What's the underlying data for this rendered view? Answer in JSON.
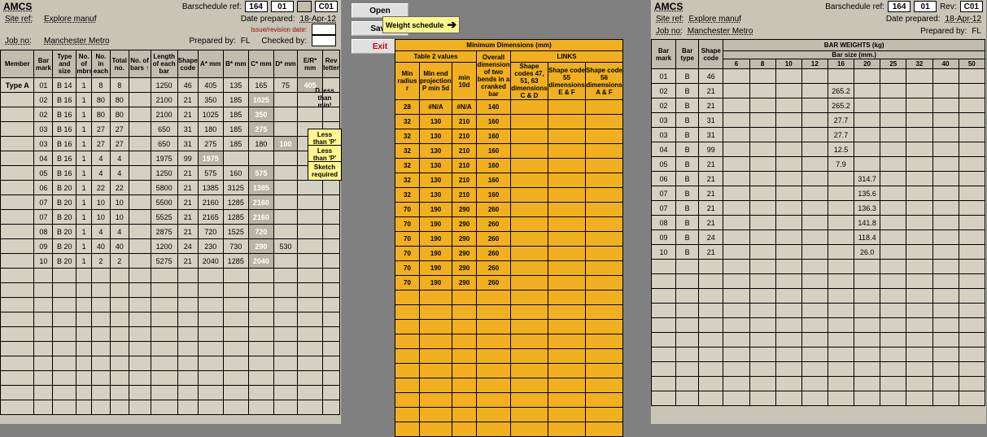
{
  "left": {
    "title": "AMCS",
    "bsr_label": "Barschedule ref:",
    "bsr": [
      "164",
      "01"
    ],
    "rev": "C01",
    "site_l": "Site ref:",
    "site": "Explore manuf",
    "date_l": "Date prepared:",
    "date": "18-Apr-12",
    "rev_note": "Issue/revision date:",
    "job_l": "Job no:",
    "job": "Manchester Metro",
    "prep_l": "Prepared by:",
    "prep": "FL",
    "chk_l": "Checked by:",
    "cols": [
      "Member",
      "Bar mark",
      "Type and size",
      "No. of mbrs",
      "No. in each",
      "Total no.",
      "No. of bars ↑",
      "Length of each bar",
      "Shape code",
      "A* mm",
      "B* mm",
      "C* mm",
      "D* mm",
      "E/R* mm",
      "Rev letter"
    ],
    "member": "Type A",
    "rows": [
      [
        "01",
        "B 14",
        "1",
        "8",
        "8",
        "",
        "1250",
        "46",
        "405",
        "135",
        "165",
        "75",
        "405",
        ""
      ],
      [
        "02",
        "B 16",
        "1",
        "80",
        "80",
        "",
        "2100",
        "21",
        "350",
        "185",
        "1025",
        "",
        "",
        ""
      ],
      [
        "02",
        "B 16",
        "1",
        "80",
        "80",
        "",
        "2100",
        "21",
        "1025",
        "185",
        "350",
        "",
        "",
        ""
      ],
      [
        "03",
        "B 16",
        "1",
        "27",
        "27",
        "",
        "650",
        "31",
        "180",
        "185",
        "275",
        "",
        "",
        ""
      ],
      [
        "03",
        "B 16",
        "1",
        "27",
        "27",
        "",
        "650",
        "31",
        "275",
        "185",
        "180",
        "100",
        "",
        ""
      ],
      [
        "04",
        "B 16",
        "1",
        "4",
        "4",
        "",
        "1975",
        "99",
        "1975",
        "",
        "",
        "",
        "",
        ""
      ],
      [
        "05",
        "B 16",
        "1",
        "4",
        "4",
        "",
        "1250",
        "21",
        "575",
        "160",
        "575",
        "",
        "",
        ""
      ],
      [
        "06",
        "B 20",
        "1",
        "22",
        "22",
        "",
        "5800",
        "21",
        "1385",
        "3125",
        "1385",
        "",
        "",
        ""
      ],
      [
        "07",
        "B 20",
        "1",
        "10",
        "10",
        "",
        "5500",
        "21",
        "2160",
        "1285",
        "2160",
        "",
        "",
        ""
      ],
      [
        "07",
        "B 20",
        "1",
        "10",
        "10",
        "",
        "5525",
        "21",
        "2165",
        "1285",
        "2160",
        "",
        "",
        ""
      ],
      [
        "08",
        "B 20",
        "1",
        "4",
        "4",
        "",
        "2875",
        "21",
        "720",
        "1525",
        "720",
        "",
        "",
        ""
      ],
      [
        "09",
        "B 20",
        "1",
        "40",
        "40",
        "",
        "1200",
        "24",
        "230",
        "730",
        "290",
        "530",
        "",
        ""
      ],
      [
        "10",
        "B 20",
        "1",
        "2",
        "2",
        "",
        "5275",
        "21",
        "2040",
        "1285",
        "2040",
        "",
        "",
        ""
      ]
    ],
    "whiteVals": {
      "0": {
        "12": "405"
      },
      "1": {
        "10": "1025"
      },
      "2": {
        "10": "350"
      },
      "3": {
        "10": "275"
      },
      "4": {
        "11": "100"
      },
      "5": {
        "8": "1975"
      },
      "6": {
        "10": "575"
      },
      "7": {
        "10": "1385"
      },
      "8": {
        "10": "2160"
      },
      "9": {
        "10": "2160"
      },
      "10": {
        "10": "720"
      },
      "11": {
        "10": "290"
      },
      "12": {
        "10": "2040"
      }
    },
    "warn1": "D less than min!",
    "notes": [
      "Less than 'P' in table",
      "Less than 'P' in table",
      "Sketch required"
    ]
  },
  "mid": {
    "btns": [
      "Open",
      "Save",
      "Exit"
    ],
    "arrow": "Weight schedule",
    "title": "Minimum Dimensions (mm)",
    "h2": [
      "Table 2 values",
      "Overall dimension of two bends in a cranked bar",
      "LINKS"
    ],
    "h3": [
      "Min radius r",
      "Min end projection, P min 5d",
      "min 10d",
      "Shape codes 47, 51, 63 dimensions C & D",
      "Shape code 55 dimensions E & F",
      "Shape code 56 dimensions A & F"
    ],
    "rows": [
      [
        "28",
        "#N/A",
        "#N/A",
        "140",
        "",
        "",
        ""
      ],
      [
        "32",
        "130",
        "210",
        "160",
        "",
        "",
        ""
      ],
      [
        "32",
        "130",
        "210",
        "160",
        "",
        "",
        ""
      ],
      [
        "32",
        "130",
        "210",
        "160",
        "",
        "",
        ""
      ],
      [
        "32",
        "130",
        "210",
        "160",
        "",
        "",
        ""
      ],
      [
        "32",
        "130",
        "210",
        "160",
        "",
        "",
        ""
      ],
      [
        "32",
        "130",
        "210",
        "160",
        "",
        "",
        ""
      ],
      [
        "70",
        "190",
        "290",
        "260",
        "",
        "",
        ""
      ],
      [
        "70",
        "190",
        "290",
        "260",
        "",
        "",
        ""
      ],
      [
        "70",
        "190",
        "290",
        "260",
        "",
        "",
        ""
      ],
      [
        "70",
        "190",
        "290",
        "260",
        "",
        "",
        ""
      ],
      [
        "70",
        "190",
        "290",
        "260",
        "",
        "",
        ""
      ],
      [
        "70",
        "190",
        "290",
        "260",
        "",
        "",
        ""
      ]
    ]
  },
  "right": {
    "title": "AMCS",
    "bsr_label": "Barschedule ref:",
    "bsr": [
      "164",
      "01"
    ],
    "rev_l": "Rev:",
    "rev": "C01",
    "site_l": "Site ref:",
    "site": "Explore manuf",
    "date_l": "Date prepared:",
    "date": "18-Apr-12",
    "job_l": "Job no:",
    "job": "Manchester Metro",
    "prep_l": "Prepared by:",
    "prep": "FL",
    "cols_l": [
      "Bar mark",
      "Bar type",
      "Shape code"
    ],
    "weights_title": "BAR WEIGHTS (kg)",
    "sub": "Bar size (mm.)",
    "sizes": [
      "6",
      "8",
      "10",
      "12",
      "16",
      "20",
      "25",
      "32",
      "40",
      "50"
    ],
    "rows": [
      [
        "01",
        "B",
        "46",
        "",
        "",
        "",
        "",
        "",
        "",
        "",
        "",
        "",
        ""
      ],
      [
        "02",
        "B",
        "21",
        "",
        "",
        "",
        "",
        "265.2",
        "",
        "",
        "",
        "",
        ""
      ],
      [
        "02",
        "B",
        "21",
        "",
        "",
        "",
        "",
        "265.2",
        "",
        "",
        "",
        "",
        ""
      ],
      [
        "03",
        "B",
        "31",
        "",
        "",
        "",
        "",
        "27.7",
        "",
        "",
        "",
        "",
        ""
      ],
      [
        "03",
        "B",
        "31",
        "",
        "",
        "",
        "",
        "27.7",
        "",
        "",
        "",
        "",
        ""
      ],
      [
        "04",
        "B",
        "99",
        "",
        "",
        "",
        "",
        "12.5",
        "",
        "",
        "",
        "",
        ""
      ],
      [
        "05",
        "B",
        "21",
        "",
        "",
        "",
        "",
        "7.9",
        "",
        "",
        "",
        "",
        ""
      ],
      [
        "06",
        "B",
        "21",
        "",
        "",
        "",
        "",
        "",
        "314.7",
        "",
        "",
        "",
        ""
      ],
      [
        "07",
        "B",
        "21",
        "",
        "",
        "",
        "",
        "",
        "135.6",
        "",
        "",
        "",
        ""
      ],
      [
        "07",
        "B",
        "21",
        "",
        "",
        "",
        "",
        "",
        "136.3",
        "",
        "",
        "",
        ""
      ],
      [
        "08",
        "B",
        "21",
        "",
        "",
        "",
        "",
        "",
        "141.8",
        "",
        "",
        "",
        ""
      ],
      [
        "09",
        "B",
        "24",
        "",
        "",
        "",
        "",
        "",
        "118.4",
        "",
        "",
        "",
        ""
      ],
      [
        "10",
        "B",
        "21",
        "",
        "",
        "",
        "",
        "",
        "26.0",
        "",
        "",
        "",
        ""
      ]
    ]
  }
}
